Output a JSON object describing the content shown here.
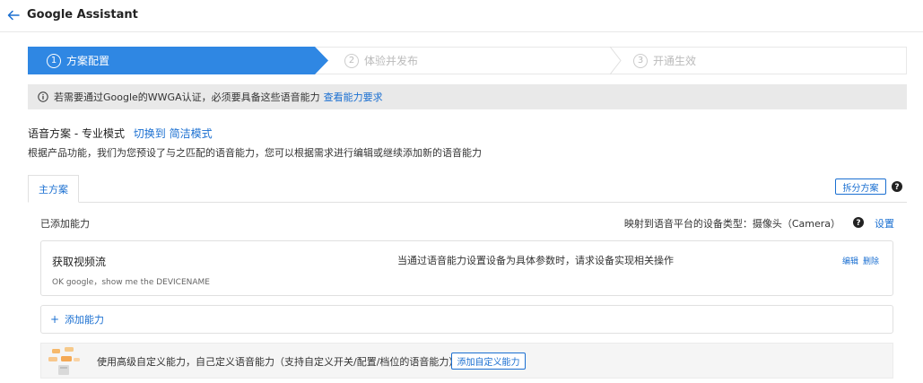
{
  "header": {
    "title": "Google Assistant"
  },
  "steps": [
    {
      "num": "1",
      "label": "方案配置",
      "state": "active"
    },
    {
      "num": "2",
      "label": "体验并发布",
      "state": "inactive"
    },
    {
      "num": "3",
      "label": "开通生效",
      "state": "inactive"
    }
  ],
  "notice": {
    "text": "若需要通过Google的WWGA认证，必须要具备这些语音能力",
    "link": "查看能力要求"
  },
  "scheme": {
    "title": "语音方案 - 专业模式",
    "switch_link": "切换到 简洁模式",
    "description": "根据产品功能，我们为您预设了与之匹配的语音能力，您可以根据需求进行编辑或继续添加新的语音能力"
  },
  "tabs": {
    "main": "主方案",
    "split_button": "拆分方案"
  },
  "capabilities": {
    "added_label": "已添加能力",
    "device_mapping": "映射到语音平台的设备类型：摄像头（Camera）",
    "settings_link": "设置",
    "items": [
      {
        "title": "获取视频流",
        "example": "OK google，show me the DEVICENAME",
        "description": "当通过语音能力设置设备为具体参数时，请求设备实现相关操作",
        "edit": "编辑",
        "delete": "删除"
      }
    ],
    "add_label": "添加能力"
  },
  "custom": {
    "text": "使用高级自定义能力，自己定义语音能力（支持自定义开关/配置/档位的语音能力）",
    "button": "添加自定义能力"
  },
  "colors": {
    "accent": "#1a6fd1",
    "step_active": "#2f87e3"
  }
}
